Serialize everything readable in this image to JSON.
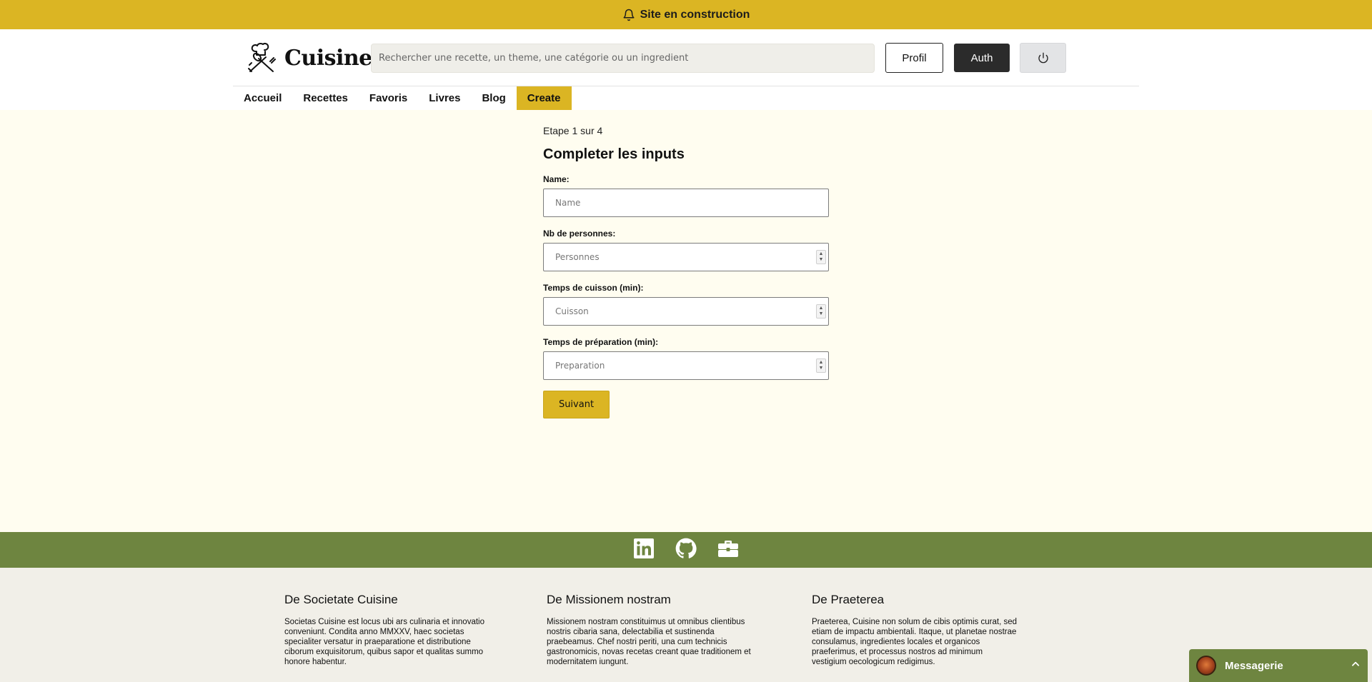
{
  "banner": {
    "icon": "bell-icon",
    "text": "Site en construction"
  },
  "header": {
    "logo_icon": "chef-utensils-icon",
    "logo_text": "Cuisine",
    "search_placeholder": "Rechercher une recette, un theme, une catégorie ou un ingredient",
    "profil_label": "Profil",
    "auth_label": "Auth",
    "power_icon": "power-icon"
  },
  "nav": {
    "items": [
      {
        "label": "Accueil"
      },
      {
        "label": "Recettes"
      },
      {
        "label": "Favoris"
      },
      {
        "label": "Livres"
      },
      {
        "label": "Blog"
      },
      {
        "label": "Create",
        "active": true
      }
    ]
  },
  "form": {
    "step": "Etape 1 sur 4",
    "title": "Completer les inputs",
    "fields": [
      {
        "label": "Name:",
        "placeholder": "Name",
        "type": "text"
      },
      {
        "label": "Nb de personnes:",
        "placeholder": "Personnes",
        "type": "number"
      },
      {
        "label": "Temps de cuisson (min):",
        "placeholder": "Cuisson",
        "type": "number"
      },
      {
        "label": "Temps de préparation (min):",
        "placeholder": "Preparation",
        "type": "number"
      }
    ],
    "next_label": "Suivant"
  },
  "social": {
    "icons": [
      "linkedin-icon",
      "github-icon",
      "briefcase-icon"
    ]
  },
  "footer": {
    "columns": [
      {
        "title": "De Societate Cuisine",
        "text": "Societas Cuisine est locus ubi ars culinaria et innovatio conveniunt. Condita anno MMXXV, haec societas specialiter versatur in praeparatione et distributione ciborum exquisitorum, quibus sapor et qualitas summo honore habentur."
      },
      {
        "title": "De Missionem nostram",
        "text": "Missionem nostram constituimus ut omnibus clientibus nostris cibaria sana, delectabilia et sustinenda praebeamus. Chef nostri periti, una cum technicis gastronomicis, novas recetas creant quae traditionem et modernitatem iungunt."
      },
      {
        "title": "De Praeterea",
        "text": "Praeterea, Cuisine non solum de cibis optimis curat, sed etiam de impactu ambientali. Itaque, ut planetae nostrae consulamus, ingredientes locales et organicos praeferimus, et processus nostros ad minimum vestigium oecologicum redigimus."
      }
    ]
  },
  "messagerie": {
    "label": "Messagerie",
    "icon": "chevron-up-icon"
  },
  "colors": {
    "accent": "#dbb523",
    "social_bar": "#6e8540",
    "page_bg": "#fffdf0",
    "footer_bg": "#f1efe8"
  }
}
